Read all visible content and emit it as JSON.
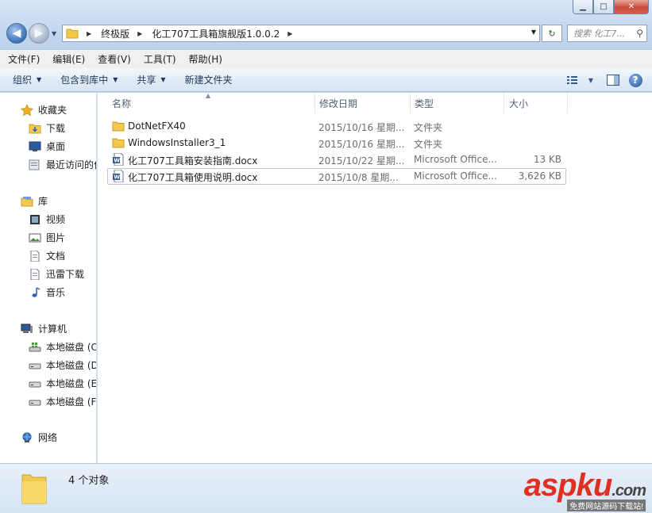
{
  "window": {
    "minimize": "▁",
    "maximize": "□",
    "close": "✕"
  },
  "address": {
    "crumbs": [
      "终极版",
      "化工707工具箱旗舰版1.0.0.2"
    ],
    "search_placeholder": "搜索 化工7..."
  },
  "menu": [
    "文件(F)",
    "编辑(E)",
    "查看(V)",
    "工具(T)",
    "帮助(H)"
  ],
  "toolbar": {
    "organize": "组织",
    "include_library": "包含到库中",
    "share": "共享",
    "new_folder": "新建文件夹"
  },
  "sidebar": {
    "favorites": {
      "label": "收藏夹",
      "items": [
        "下载",
        "桌面",
        "最近访问的位置"
      ]
    },
    "library": {
      "label": "库",
      "items": [
        "视频",
        "图片",
        "文档",
        "迅雷下载",
        "音乐"
      ]
    },
    "computer": {
      "label": "计算机",
      "items": [
        "本地磁盘 (C:)",
        "本地磁盘 (D:)",
        "本地磁盘 (E:)",
        "本地磁盘 (F:)"
      ]
    },
    "network": {
      "label": "网络"
    }
  },
  "columns": {
    "name": "名称",
    "date": "修改日期",
    "type": "类型",
    "size": "大小"
  },
  "files": [
    {
      "name": "DotNetFX40",
      "date": "2015/10/16 星期...",
      "type": "文件夹",
      "size": "",
      "kind": "folder"
    },
    {
      "name": "WindowsInstaller3_1",
      "date": "2015/10/16 星期...",
      "type": "文件夹",
      "size": "",
      "kind": "folder"
    },
    {
      "name": "化工707工具箱安装指南.docx",
      "date": "2015/10/22 星期...",
      "type": "Microsoft Office...",
      "size": "13 KB",
      "kind": "doc"
    },
    {
      "name": "化工707工具箱使用说明.docx",
      "date": "2015/10/8 星期...",
      "type": "Microsoft Office...",
      "size": "3,626 KB",
      "kind": "doc",
      "selected": true
    }
  ],
  "status": {
    "count": "4 个对象"
  },
  "watermark": {
    "main_a": "asp",
    "main_b": "ku",
    "main_c": ".com",
    "sub": "免费网站源码下载站!"
  },
  "colors": {
    "accent": "#c9dcf2",
    "folder": "#f2c94c",
    "watermark_red": "#e03020"
  }
}
